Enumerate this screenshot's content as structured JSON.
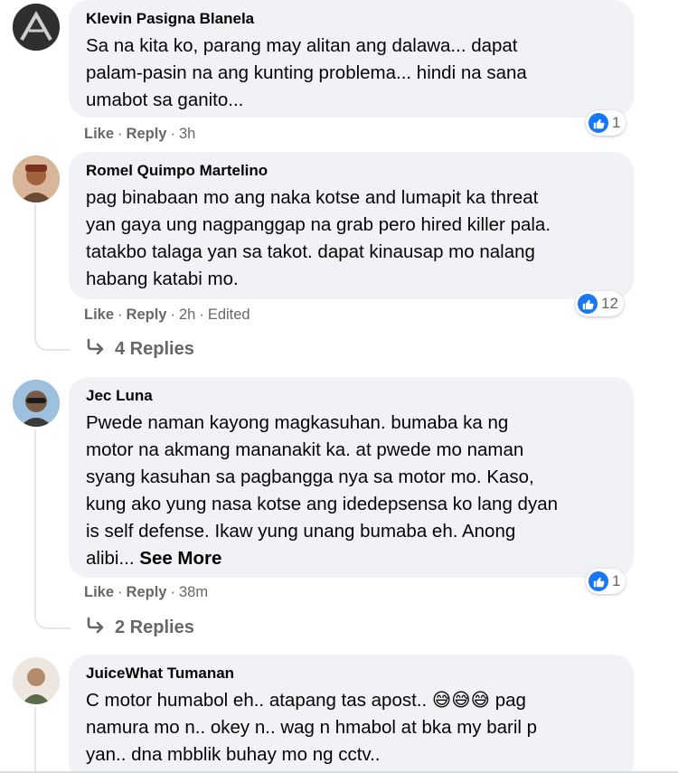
{
  "comments": [
    {
      "author": "Klevin Pasigna Blanela",
      "text": "Sa na kita ko, parang may alitan ang dalawa... dapat\npalam-pasin na ang kunting problema... hindi na sana\numabot sa ganito...",
      "reaction_count": "1",
      "like": "Like",
      "reply": "Reply",
      "time": "3h"
    },
    {
      "author": "Romel Quimpo Martelino",
      "text": "pag binabaan mo ang naka kotse and lumapit ka threat\nyan gaya ung nagpanggap na grab pero hired killer pala.\ntatakbo talaga yan sa takot. dapat kinausap mo nalang\nhabang katabi mo.",
      "reaction_count": "12",
      "like": "Like",
      "reply": "Reply",
      "time": "2h",
      "edited": "Edited",
      "replies": "4 Replies"
    },
    {
      "author": "Jec Luna",
      "text": "Pwede naman kayong magkasuhan. bumaba ka ng\nmotor na akmang mananakit ka. at pwede mo naman\nsyang kasuhan sa pagbangga nya sa motor mo. Kaso,\nkung ako yung nasa kotse ang idedepsensa ko lang dyan\nis self defense. Ikaw yung unang bumaba eh. Anong\nalibi...",
      "see_more": "See More",
      "reaction_count": "1",
      "like": "Like",
      "reply": "Reply",
      "time": "38m",
      "replies": "2 Replies"
    },
    {
      "author": "JuiceWhat Tumanan",
      "text_line1_a": "C motor humabol eh.. atapang tas apost.. ",
      "emoji": "😅😅😅",
      "text_line1_b": " pag",
      "text_rest": "namura mo n.. okey n.. wag n hmabol at bka my baril p\nyan.. dna mbblik buhay mo ng cctv.."
    }
  ],
  "separator": " · "
}
